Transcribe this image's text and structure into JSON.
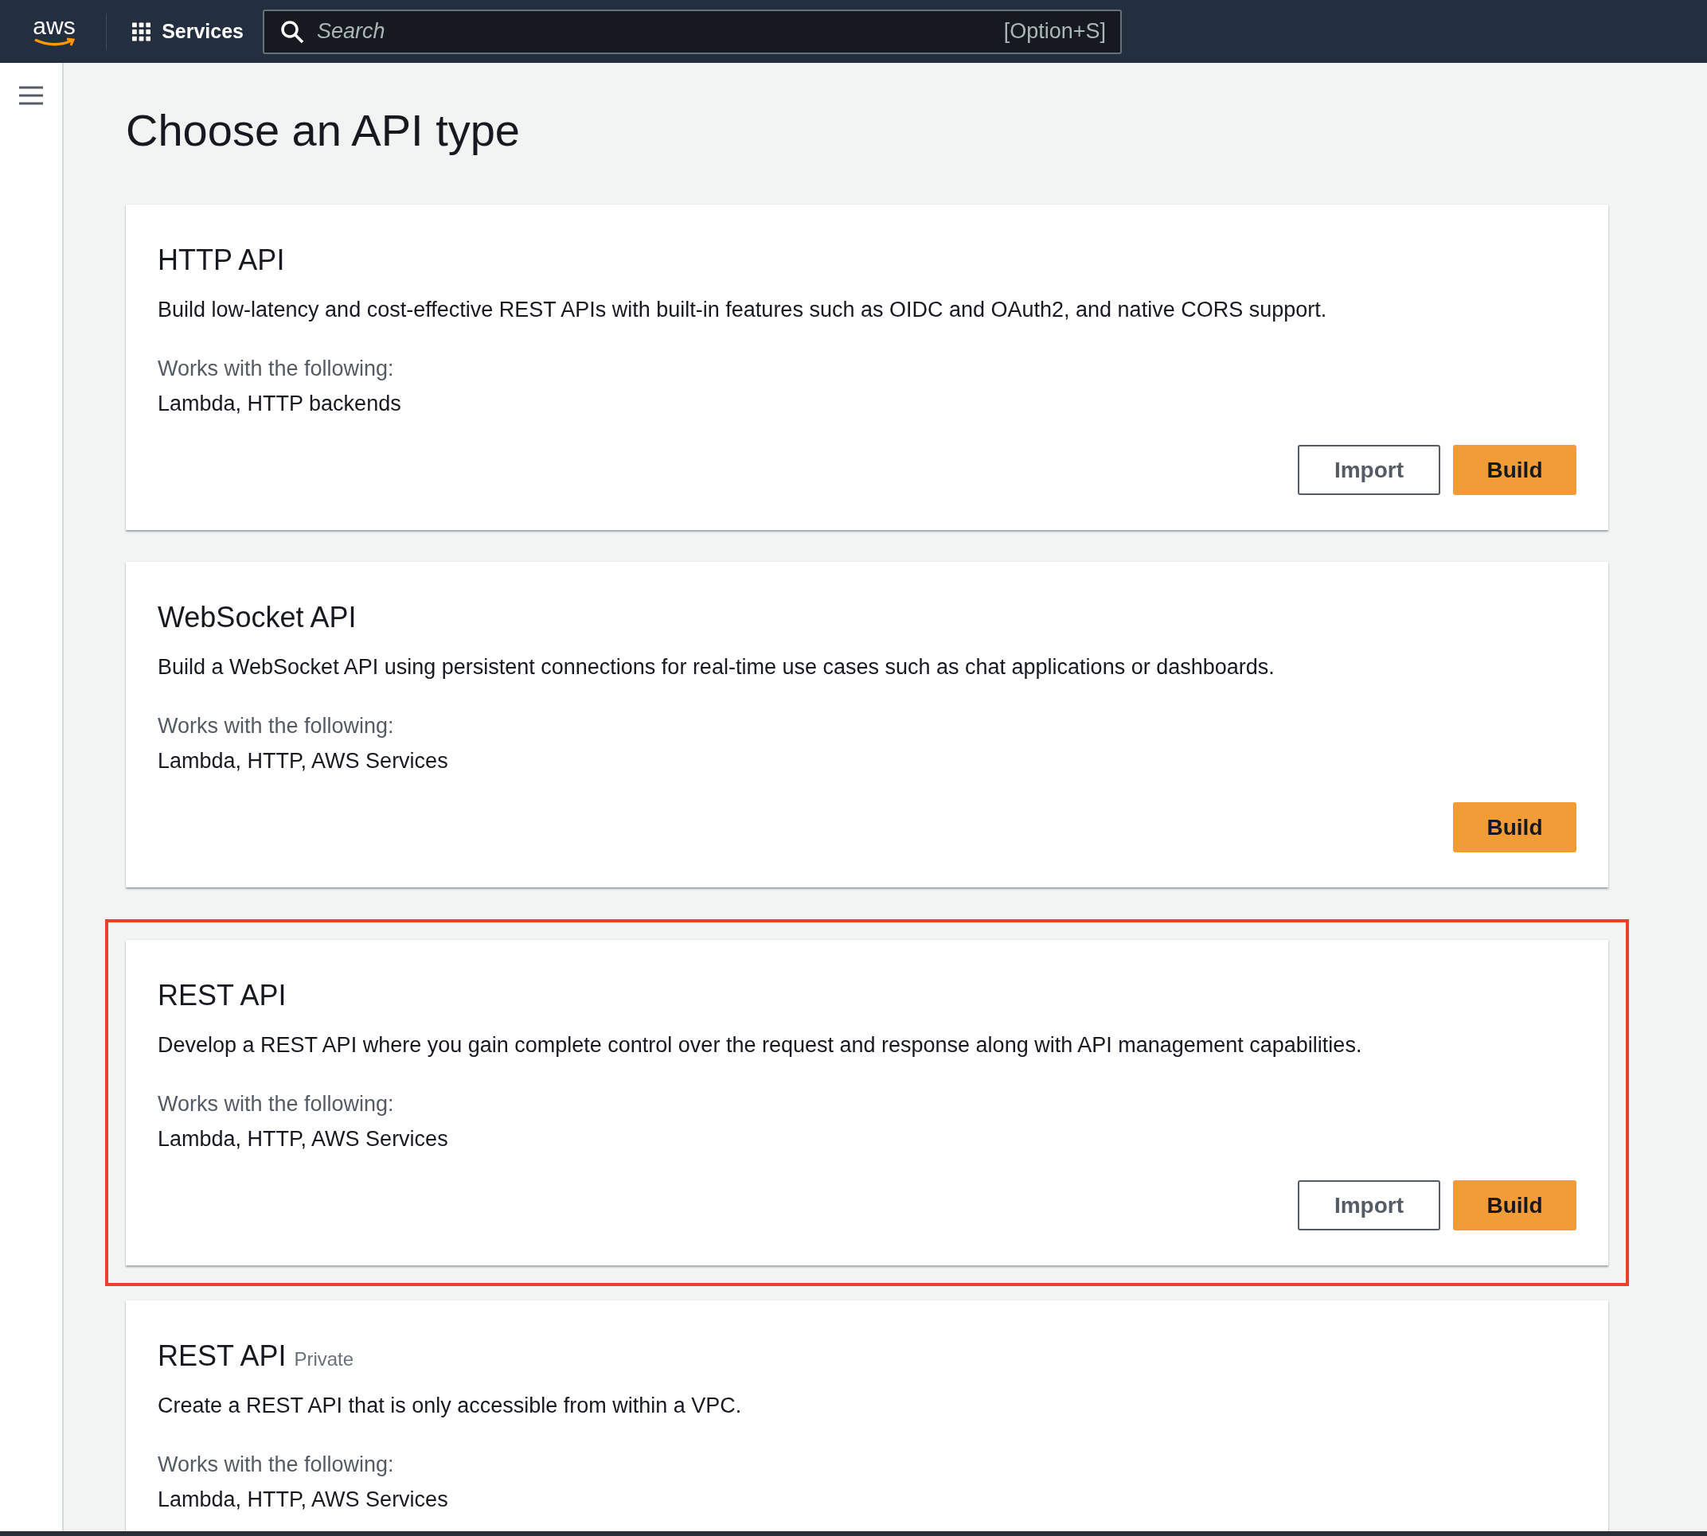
{
  "top_bar": {
    "logo": "aws",
    "services_label": "Services",
    "search": {
      "placeholder": "Search",
      "shortcut": "[Option+S]"
    }
  },
  "page_title": "Choose an API type",
  "cards": [
    {
      "title": "HTTP API",
      "description": "Build low-latency and cost-effective REST APIs with built-in features such as OIDC and OAuth2, and native CORS support.",
      "works_with_label": "Works with the following:",
      "works_with": "Lambda, HTTP backends",
      "highlighted": false,
      "buttons": [
        {
          "label": "Import",
          "kind": "normal"
        },
        {
          "label": "Build",
          "kind": "primary"
        }
      ]
    },
    {
      "title": "WebSocket API",
      "description": "Build a WebSocket API using persistent connections for real-time use cases such as chat applications or dashboards.",
      "works_with_label": "Works with the following:",
      "works_with": "Lambda, HTTP, AWS Services",
      "highlighted": false,
      "buttons": [
        {
          "label": "Build",
          "kind": "primary"
        }
      ]
    },
    {
      "title": "REST API",
      "description": "Develop a REST API where you gain complete control over the request and response along with API management capabilities.",
      "works_with_label": "Works with the following:",
      "works_with": "Lambda, HTTP, AWS Services",
      "highlighted": true,
      "buttons": [
        {
          "label": "Import",
          "kind": "normal"
        },
        {
          "label": "Build",
          "kind": "primary"
        }
      ]
    },
    {
      "title": "REST API",
      "tag": "Private",
      "description": "Create a REST API that is only accessible from within a VPC.",
      "works_with_label": "Works with the following:",
      "works_with": "Lambda, HTTP, AWS Services",
      "highlighted": false
    }
  ]
}
